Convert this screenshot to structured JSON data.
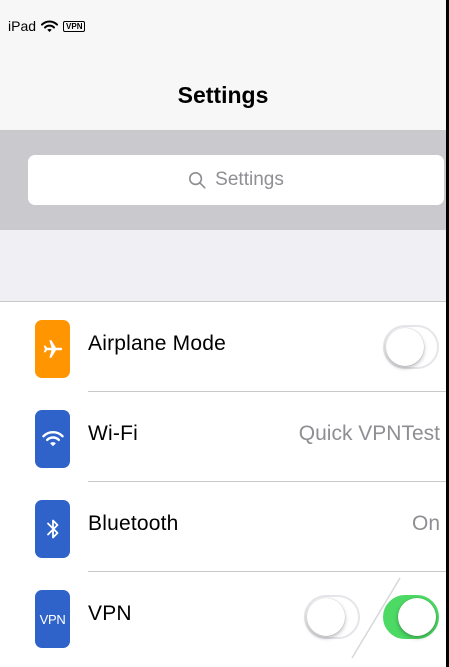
{
  "status_bar": {
    "device": "iPad",
    "wifi_icon": "wifi-icon",
    "vpn_badge": "VPN"
  },
  "nav": {
    "title": "Settings"
  },
  "search": {
    "placeholder": "Settings",
    "icon": "search-icon"
  },
  "rows": [
    {
      "label": "Airplane Mode",
      "icon": "airplane-icon",
      "icon_color": "#ff9500",
      "accessory": "toggle",
      "toggle_state": "off"
    },
    {
      "label": "Wi-Fi",
      "icon": "wifi-icon",
      "icon_color": "#2f63c9",
      "detail": "Quick VPNTest"
    },
    {
      "label": "Bluetooth",
      "icon": "bluetooth-icon",
      "icon_color": "#2f63c9",
      "detail": "On"
    },
    {
      "label": "VPN",
      "icon_text": "VPN",
      "icon_color": "#2f63c9",
      "accessory": "toggle-transition",
      "toggle_states": [
        "off",
        "on"
      ]
    }
  ],
  "colors": {
    "accent_green": "#4cd964",
    "nav_background": "#f7f7f7",
    "search_background": "#c9c9ce",
    "section_background": "#efeff4",
    "secondary_text": "#8e8e93"
  }
}
